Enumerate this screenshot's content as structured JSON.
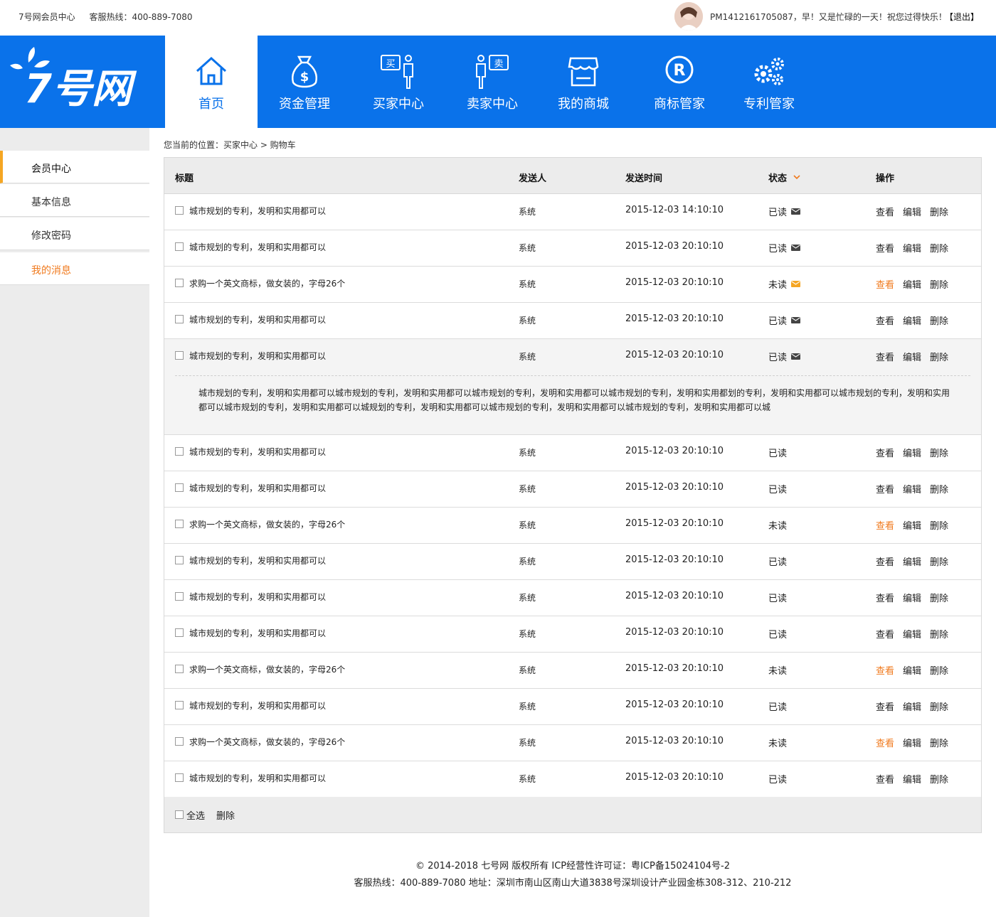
{
  "topbar": {
    "site": "7号网会员中心",
    "hotline": "客服热线：400-889-7080",
    "greeting": "PM1412161705087，早！又是忙碌的一天！祝您过得快乐！",
    "logout": "【退出】"
  },
  "nav": {
    "brand_color": "#0a72ea",
    "items": [
      {
        "label": "首页",
        "icon": "home-icon"
      },
      {
        "label": "资金管理",
        "icon": "money-bag-icon"
      },
      {
        "label": "买家中心",
        "icon": "buyer-icon"
      },
      {
        "label": "卖家中心",
        "icon": "seller-icon"
      },
      {
        "label": "我的商城",
        "icon": "store-icon"
      },
      {
        "label": "商标管家",
        "icon": "registered-icon"
      },
      {
        "label": "专利管家",
        "icon": "gears-icon"
      }
    ]
  },
  "sidebar": {
    "items": [
      {
        "label": "会员中心"
      },
      {
        "label": "基本信息"
      },
      {
        "label": "修改密码"
      },
      {
        "label": "我的消息"
      }
    ],
    "accent_color": "#f07a1e"
  },
  "breadcrumb": "您当前的位置：买家中心 >  购物车",
  "table": {
    "headers": {
      "title": "标题",
      "sender": "发送人",
      "time": "发送时间",
      "status": "状态",
      "ops": "操作"
    },
    "op_labels": {
      "view": "查看",
      "edit": "编辑",
      "delete": "删除"
    },
    "rows": [
      {
        "title": "城市规划的专利，发明和实用都可以",
        "sender": "系统",
        "time": "2015-12-03 14:10:10",
        "status": "已读"
      },
      {
        "title": "城市规划的专利，发明和实用都可以",
        "sender": "系统",
        "time": "2015-12-03 20:10:10",
        "status": "已读"
      },
      {
        "title": "求购一个英文商标，做女装的，字母26个",
        "sender": "系统",
        "time": "2015-12-03 20:10:10",
        "status": "未读"
      },
      {
        "title": "城市规划的专利，发明和实用都可以",
        "sender": "系统",
        "time": "2015-12-03 20:10:10",
        "status": "已读"
      },
      {
        "title": "城市规划的专利，发明和实用都可以",
        "sender": "系统",
        "time": "2015-12-03 20:10:10",
        "status": "已读",
        "detail": "城市规划的专利，发明和实用都可以城市规划的专利，发明和实用都可以城市规划的专利，发明和实用都可以城市规划的专利，发明和实用都划的专利，发明和实用都可以城市规划的专利，发明和实用都可以城市规划的专利，发明和实用都可以城规划的专利，发明和实用都可以城市规划的专利，发明和实用都可以城市规划的专利，发明和实用都可以城"
      },
      {
        "title": "城市规划的专利，发明和实用都可以",
        "sender": "系统",
        "time": "2015-12-03 20:10:10",
        "status": "已读"
      },
      {
        "title": "城市规划的专利，发明和实用都可以",
        "sender": "系统",
        "time": "2015-12-03 20:10:10",
        "status": "已读"
      },
      {
        "title": "求购一个英文商标，做女装的，字母26个",
        "sender": "系统",
        "time": "2015-12-03 20:10:10",
        "status": "未读"
      },
      {
        "title": "城市规划的专利，发明和实用都可以",
        "sender": "系统",
        "time": "2015-12-03 20:10:10",
        "status": "已读"
      },
      {
        "title": "城市规划的专利，发明和实用都可以",
        "sender": "系统",
        "time": "2015-12-03 20:10:10",
        "status": "已读"
      },
      {
        "title": "城市规划的专利，发明和实用都可以",
        "sender": "系统",
        "time": "2015-12-03 20:10:10",
        "status": "已读"
      },
      {
        "title": "求购一个英文商标，做女装的，字母26个",
        "sender": "系统",
        "time": "2015-12-03 20:10:10",
        "status": "未读"
      },
      {
        "title": "城市规划的专利，发明和实用都可以",
        "sender": "系统",
        "time": "2015-12-03 20:10:10",
        "status": "已读"
      },
      {
        "title": "求购一个英文商标，做女装的，字母26个",
        "sender": "系统",
        "time": "2015-12-03 20:10:10",
        "status": "未读"
      },
      {
        "title": "城市规划的专利，发明和实用都可以",
        "sender": "系统",
        "time": "2015-12-03 20:10:10",
        "status": "已读"
      }
    ],
    "footer": {
      "select_all": "全选",
      "delete": "删除"
    }
  },
  "footer": {
    "copyright": "© 2014-2018 七号网 版权所有 ICP经营性许可证：粤ICP备15024104号-2",
    "contact": "客服热线：400-889-7080  地址：深圳市南山区南山大道3838号深圳设计产业园金栋308-312、210-212"
  }
}
